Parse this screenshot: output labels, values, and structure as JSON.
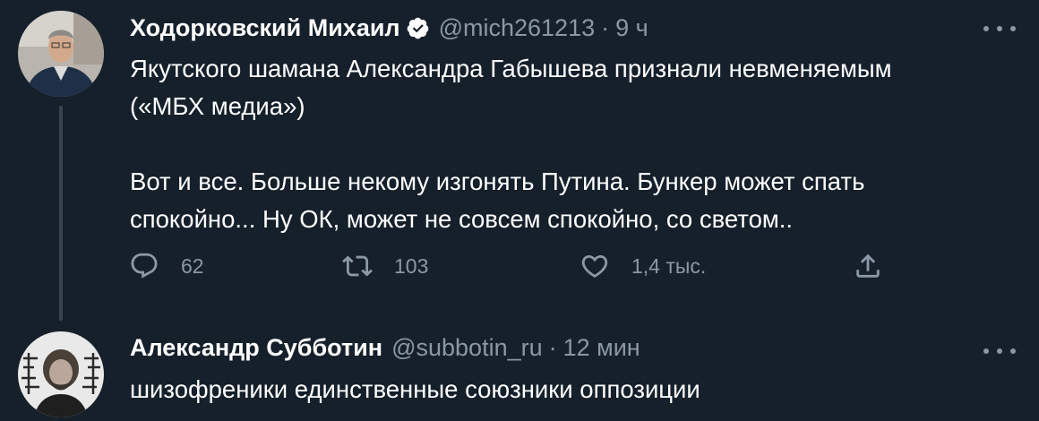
{
  "tweets": [
    {
      "author_name": "Ходорковский Михаил",
      "verified": true,
      "handle": "@mich261213",
      "separator": "·",
      "time": "9 ч",
      "text_lines": [
        "Якутского шамана Александра Габышева признали невменяемым",
        "(«МБХ медиа»)",
        "",
        "Вот и все. Больше некому изгонять Путина. Бункер может спать",
        "спокойно... Ну ОК, может не совсем спокойно, со светом.."
      ],
      "actions": {
        "reply_count": "62",
        "retweet_count": "103",
        "like_count": "1,4 тыс."
      }
    },
    {
      "author_name": "Александр Субботин",
      "handle": "@subbotin_ru",
      "separator": "·",
      "time": "12 мин",
      "text_lines": [
        "шизофреники единственные союзники оппозиции"
      ]
    }
  ],
  "icons": {
    "verified": "verified-badge-icon",
    "more": "more-dots-icon",
    "reply": "reply-icon",
    "retweet": "retweet-icon",
    "like": "heart-icon",
    "share": "share-icon"
  },
  "colors": {
    "background": "#15202b",
    "text_primary": "#ffffff",
    "text_secondary": "#8b98a5",
    "thread_line": "#38444d"
  }
}
